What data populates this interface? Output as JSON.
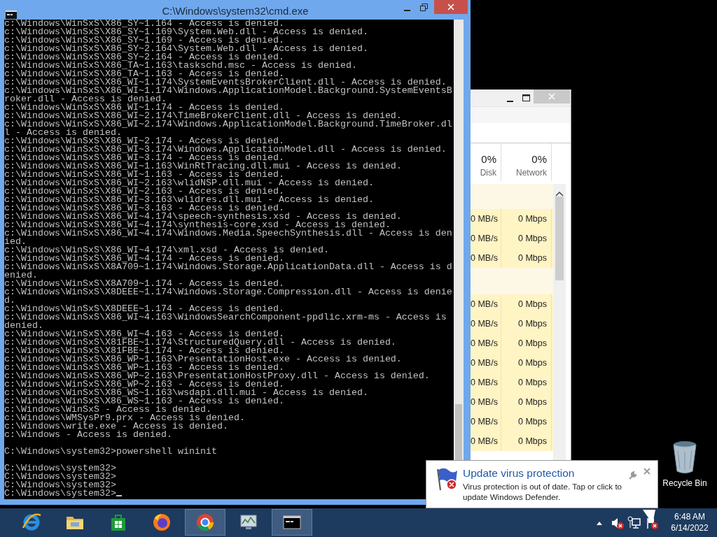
{
  "cmd_window": {
    "title": "C:\\Windows\\system32\\cmd.exe",
    "blocks": [
      [
        "c:\\Windows\\WinSxS\\X86_SY~1.164 - Access is denied.",
        "c:\\Windows\\WinSxS\\X86_SY~1.169\\System.Web.dll - Access is denied.",
        "c:\\Windows\\WinSxS\\X86_SY~1.169 - Access is denied.",
        "c:\\Windows\\WinSxS\\X86_SY~2.164\\System.Web.dll - Access is denied.",
        "c:\\Windows\\WinSxS\\X86_SY~2.164 - Access is denied.",
        "c:\\Windows\\WinSxS\\X86_TA~1.163\\taskschd.msc - Access is denied.",
        "c:\\Windows\\WinSxS\\X86_TA~1.163 - Access is denied.",
        "c:\\Windows\\WinSxS\\X86_WI~1.174\\SystemEventsBrokerClient.dll - Access is denied.",
        "c:\\Windows\\WinSxS\\X86_WI~1.174\\Windows.ApplicationModel.Background.SystemEventsB",
        "roker.dll - Access is denied.",
        "c:\\Windows\\WinSxS\\X86_WI~1.174 - Access is denied.",
        "c:\\Windows\\WinSxS\\X86_WI~2.174\\TimeBrokerClient.dll - Access is denied.",
        "c:\\Windows\\WinSxS\\X86_WI~2.174\\Windows.ApplicationModel.Background.TimeBroker.dl",
        "l - Access is denied.",
        "c:\\Windows\\WinSxS\\X86_WI~2.174 - Access is denied.",
        "c:\\Windows\\WinSxS\\X86_WI~3.174\\Windows.ApplicationModel.dll - Access is denied.",
        "c:\\Windows\\WinSxS\\X86_WI~3.174 - Access is denied.",
        "c:\\Windows\\WinSxS\\X86_WI~1.163\\WinRtTracing.dll.mui - Access is denied.",
        "c:\\Windows\\WinSxS\\X86_WI~1.163 - Access is denied.",
        "c:\\Windows\\WinSxS\\X86_WI~2.163\\wlidNSP.dll.mui - Access is denied.",
        "c:\\Windows\\WinSxS\\X86_WI~2.163 - Access is denied.",
        "c:\\Windows\\WinSxS\\X86_WI~3.163\\wlidres.dll.mui - Access is denied.",
        "c:\\Windows\\WinSxS\\X86_WI~3.163 - Access is denied.",
        "c:\\Windows\\WinSxS\\X86_WI~4.174\\speech-synthesis.xsd - Access is denied.",
        "c:\\Windows\\WinSxS\\X86_WI~4.174\\synthesis-core.xsd - Access is denied.",
        "c:\\Windows\\WinSxS\\X86_WI~4.174\\Windows.Media.SpeechSynthesis.dll - Access is den",
        "ied.",
        "c:\\Windows\\WinSxS\\X86_WI~4.174\\xml.xsd - Access is denied.",
        "c:\\Windows\\WinSxS\\X86_WI~4.174 - Access is denied.",
        "c:\\Windows\\WinSxS\\X8A709~1.174\\Windows.Storage.ApplicationData.dll - Access is d",
        "enied.",
        "c:\\Windows\\WinSxS\\X8A709~1.174 - Access is denied.",
        "c:\\Windows\\WinSxS\\X8DEEE~1.174\\Windows.Storage.Compression.dll - Access is denie",
        "d.",
        "c:\\Windows\\WinSxS\\X8DEEE~1.174 - Access is denied.",
        "c:\\Windows\\WinSxS\\X86_WI~4.163\\WindowsSearchComponent-ppdlic.xrm-ms - Access is",
        "denied.",
        "c:\\Windows\\WinSxS\\X86_WI~4.163 - Access is denied.",
        "c:\\Windows\\WinSxS\\X81FBE~1.174\\StructuredQuery.dll - Access is denied.",
        "c:\\Windows\\WinSxS\\X81FBE~1.174 - Access is denied.",
        "c:\\Windows\\WinSxS\\X86_WP~1.163\\PresentationHost.exe - Access is denied.",
        "c:\\Windows\\WinSxS\\X86_WP~1.163 - Access is denied.",
        "c:\\Windows\\WinSxS\\X86_WP~2.163\\PresentationHostProxy.dll - Access is denied.",
        "c:\\Windows\\WinSxS\\X86_WP~2.163 - Access is denied.",
        "c:\\Windows\\WinSxS\\X86_WS~1.163\\wsdapi.dll.mui - Access is denied.",
        "c:\\Windows\\WinSxS\\X86_WS~1.163 - Access is denied.",
        "c:\\Windows\\WinSxS - Access is denied.",
        "c:\\Windows\\WMSysPr9.prx - Access is denied.",
        "c:\\Windows\\write.exe - Access is denied.",
        "c:\\Windows - Access is denied."
      ],
      [
        "C:\\Windows\\system32>powershell wininit"
      ],
      [
        "C:\\Windows\\system32>",
        "C:\\Windows\\system32>",
        "C:\\Windows\\system32>",
        "C:\\Windows\\system32>"
      ]
    ],
    "cursor_visible": true
  },
  "task_manager": {
    "columns": [
      {
        "percent": "0%",
        "label": "Disk"
      },
      {
        "percent": "0%",
        "label": "Network"
      }
    ],
    "rows": [
      {
        "kind": "group"
      },
      {
        "kind": "process",
        "disk": "0 MB/s",
        "network": "0 Mbps"
      },
      {
        "kind": "process",
        "disk": "0 MB/s",
        "network": "0 Mbps"
      },
      {
        "kind": "process",
        "disk": "0 MB/s",
        "network": "0 Mbps"
      },
      {
        "kind": "group"
      },
      {
        "kind": "process",
        "disk": "0 MB/s",
        "network": "0 Mbps"
      },
      {
        "kind": "process",
        "disk": "0 MB/s",
        "network": "0 Mbps"
      },
      {
        "kind": "process",
        "disk": "0 MB/s",
        "network": "0 Mbps"
      },
      {
        "kind": "process",
        "disk": "0 MB/s",
        "network": "0 Mbps"
      },
      {
        "kind": "process",
        "disk": "0 MB/s",
        "network": "0 Mbps"
      },
      {
        "kind": "process",
        "disk": "0 MB/s",
        "network": "0 Mbps"
      },
      {
        "kind": "process",
        "disk": "0 MB/s",
        "network": "0 Mbps"
      },
      {
        "kind": "process",
        "disk": "0 MB/s",
        "network": "0 Mbps"
      }
    ]
  },
  "desktop_icons": [
    {
      "label": "Recycle Bin"
    }
  ],
  "notification": {
    "title": "Update virus protection",
    "body": "Virus protection is out of date. Tap or click to update Windows Defender."
  },
  "taskbar": {
    "apps": [
      {
        "kind": "ie",
        "active": false
      },
      {
        "kind": "folder",
        "active": false
      },
      {
        "kind": "store",
        "active": false
      },
      {
        "kind": "firefox",
        "active": false
      },
      {
        "kind": "chrome",
        "active": true
      },
      {
        "kind": "monitor",
        "active": false
      },
      {
        "kind": "console",
        "active": true
      }
    ],
    "clock": {
      "time": "6:48 AM",
      "date": "6/14/2022"
    }
  }
}
